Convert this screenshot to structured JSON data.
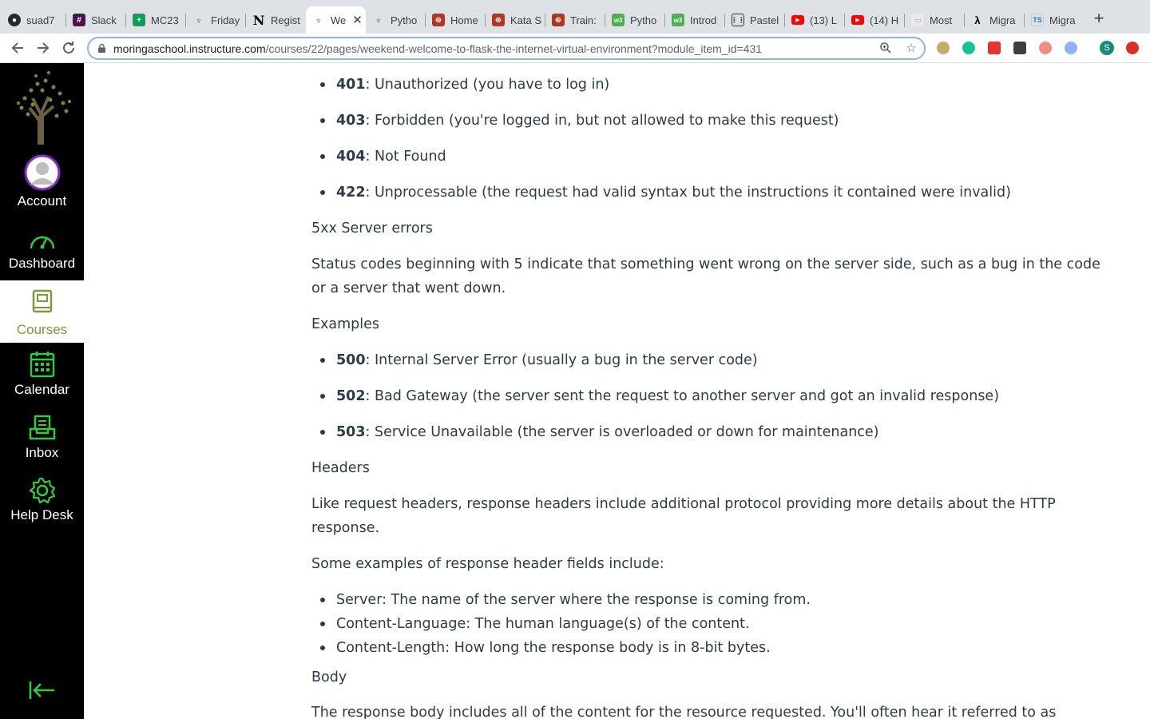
{
  "browser": {
    "tabs": [
      {
        "title": "suad7",
        "icon": "github-icon"
      },
      {
        "title": "Slack",
        "icon": "slack-icon"
      },
      {
        "title": "MC23",
        "icon": "sheets-icon"
      },
      {
        "title": "Friday",
        "icon": "tree-icon"
      },
      {
        "title": "Regist",
        "icon": "notion-icon"
      },
      {
        "title": "We",
        "icon": "tree-icon",
        "active": true
      },
      {
        "title": "Pytho",
        "icon": "tree-icon"
      },
      {
        "title": "Home",
        "icon": "codewars-icon"
      },
      {
        "title": "Kata S",
        "icon": "codewars-icon"
      },
      {
        "title": "Train:",
        "icon": "codewars-icon"
      },
      {
        "title": "Pytho",
        "icon": "w3schools-icon"
      },
      {
        "title": "Introd",
        "icon": "w3schools-icon"
      },
      {
        "title": "Pastel",
        "icon": "pastel-icon"
      },
      {
        "title": "(13) L",
        "icon": "youtube-icon"
      },
      {
        "title": "(14) H",
        "icon": "youtube-icon"
      },
      {
        "title": "Most",
        "icon": "image-icon"
      },
      {
        "title": "Migra",
        "icon": "lambda-icon"
      },
      {
        "title": "Migra",
        "icon": "ts-icon"
      }
    ],
    "url_host": "moringaschool.instructure.com",
    "url_path": "/courses/22/pages/weekend-welcome-to-flask-the-internet-virtual-environment?module_item_id=431",
    "profile_initial": "S"
  },
  "nav": {
    "account": "Account",
    "dashboard": "Dashboard",
    "courses": "Courses",
    "calendar": "Calendar",
    "inbox": "Inbox",
    "helpdesk": "Help Desk"
  },
  "content": {
    "list4xx": [
      {
        "code": "401",
        "text": ": Unauthorized (you have to log in)"
      },
      {
        "code": "403",
        "text": ": Forbidden (you're logged in, but not allowed to make this request)"
      },
      {
        "code": "404",
        "text": ": Not Found"
      },
      {
        "code": "422",
        "text": ": Unprocessable (the request had valid syntax but the instructions it contained were invalid)"
      }
    ],
    "h5xx": "5xx Server errors",
    "p5xx": "Status codes beginning with 5 indicate that something went wrong on the server side, such as a bug in the code or a server that went down.",
    "examples": "Examples",
    "list5xx": [
      {
        "code": "500",
        "text": ": Internal Server Error (usually a bug in the server code)"
      },
      {
        "code": "502",
        "text": ": Bad Gateway (the server sent the request to another server and got an invalid response)"
      },
      {
        "code": "503",
        "text": ": Service Unavailable (the server is overloaded or down for maintenance)"
      }
    ],
    "headers": "Headers",
    "pheaders": "Like request headers, response headers include additional protocol providing more details about the HTTP response.",
    "pexamples": "Some examples of response header fields include:",
    "headerfields": [
      "Server: The name of the server where the response is coming from.",
      "Content-Language: The human language(s) of the content.",
      "Content-Length: How long the response body is in 8-bit bytes."
    ],
    "body": "Body",
    "pbody": "The response body includes all of the content for the resource requested. You'll often hear it referred to as"
  },
  "colors": {
    "nav_bg": "#000000",
    "nav_icon": "#2ecc40",
    "courses_active": "#7a9a3c",
    "text": "#2d3b45"
  }
}
